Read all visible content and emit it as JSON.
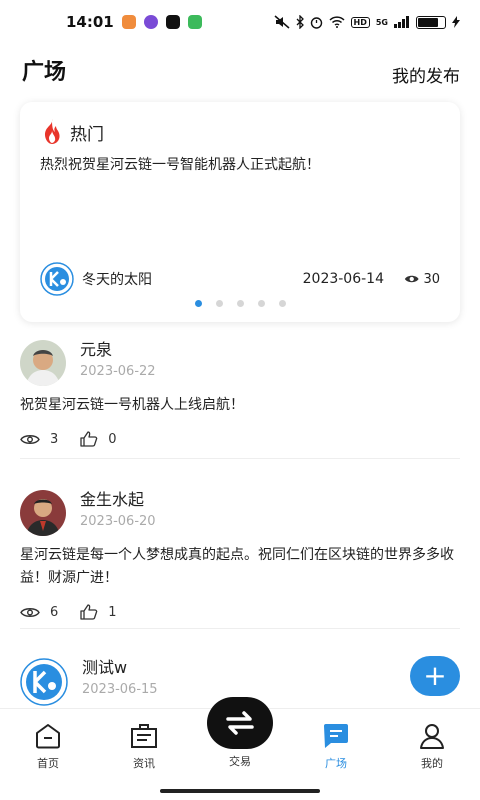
{
  "status_bar": {
    "time": "14:01",
    "network": "5G",
    "hd": "HD",
    "battery_level": 0.85
  },
  "header": {
    "title": "广场",
    "my_posts": "我的发布"
  },
  "hot_card": {
    "label": "热门",
    "text": "热烈祝贺星河云链一号智能机器人正式起航！",
    "author": "冬天的太阳",
    "date": "2023-06-14",
    "views": "30",
    "pages": 5,
    "active_page": 0
  },
  "posts": [
    {
      "author": "元泉",
      "date": "2023-06-22",
      "body": "祝贺星河云链一号机器人上线启航！",
      "views": "3",
      "likes": "0"
    },
    {
      "author": "金生水起",
      "date": "2023-06-20",
      "body": "星河云链是每一个人梦想成真的起点。祝同仁们在区块链的世界多多收益！财源广进！",
      "views": "6",
      "likes": "1"
    },
    {
      "author": "测试w",
      "date": "2023-06-15"
    }
  ],
  "fab": {
    "label": "+"
  },
  "tabs": [
    {
      "label": "首页",
      "icon": "home-icon"
    },
    {
      "label": "资讯",
      "icon": "news-icon"
    },
    {
      "label": "交易",
      "icon": "exchange-icon"
    },
    {
      "label": "广场",
      "icon": "square-icon"
    },
    {
      "label": "我的",
      "icon": "profile-icon"
    }
  ],
  "colors": {
    "accent": "#2a8ee0",
    "text": "#222222",
    "muted": "#aaaaaa"
  }
}
